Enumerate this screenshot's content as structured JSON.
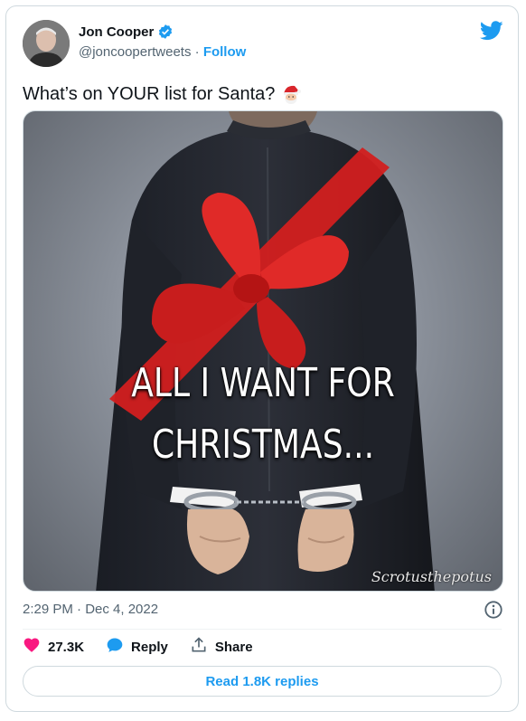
{
  "tweet": {
    "author": {
      "name": "Jon Cooper",
      "handle": "@joncoopertweets",
      "follow_label": "Follow"
    },
    "text": "What’s on YOUR list for Santa?",
    "image": {
      "caption_line1": "ALL I WANT FOR",
      "caption_line2": "CHRISTMAS...",
      "watermark": "Scrotusthepotus"
    },
    "timestamp": "2:29 PM · Dec 4, 2022",
    "likes": "27.3K",
    "reply_label": "Reply",
    "share_label": "Share",
    "read_replies": "Read 1.8K replies"
  },
  "icons": {
    "verified": "verified-badge-icon",
    "twitter": "twitter-bird-icon",
    "santa": "santa-emoji-icon",
    "info": "info-icon",
    "like": "heart-icon",
    "reply": "reply-bubble-icon",
    "share": "share-arrow-icon"
  },
  "colors": {
    "accent": "#1d9bf0",
    "like": "#f91880",
    "muted": "#536471",
    "text": "#0f1419"
  }
}
